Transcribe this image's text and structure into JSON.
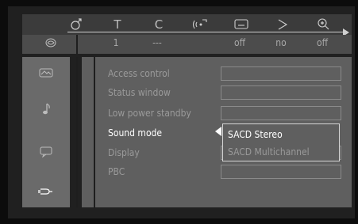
{
  "topbar": {
    "icons": [
      {
        "name": "audio-language-icon",
        "glyph": "♂"
      },
      {
        "name": "title-icon",
        "glyph": "T"
      },
      {
        "name": "chapter-icon",
        "glyph": "C"
      },
      {
        "name": "audio-channel-icon",
        "glyph": "((·"
      },
      {
        "name": "subtitle-icon",
        "glyph": "▭"
      },
      {
        "name": "angle-icon",
        "glyph": "◇"
      },
      {
        "name": "zoom-icon",
        "glyph": "⊕"
      }
    ]
  },
  "status": {
    "disc_icon": "disc-icon",
    "values": [
      "1",
      "---",
      "off",
      "no",
      "off"
    ]
  },
  "sidebar": {
    "icons": [
      {
        "name": "picture-settings-icon",
        "glyph": "⌒"
      },
      {
        "name": "music-note-icon",
        "glyph": "♪"
      },
      {
        "name": "speech-bubble-icon",
        "glyph": "▭"
      },
      {
        "name": "plug-icon",
        "glyph": "⊂"
      }
    ]
  },
  "menu": {
    "items": [
      {
        "label": "Access control"
      },
      {
        "label": "Status window"
      },
      {
        "label": "Low power standby"
      },
      {
        "label": "Sound mode"
      },
      {
        "label": "Display"
      },
      {
        "label": "PBC"
      }
    ],
    "active_index": 3
  },
  "popup": {
    "options": [
      "SACD Stereo",
      "SACD Multichannel"
    ],
    "selected": "SACD Stereo"
  }
}
